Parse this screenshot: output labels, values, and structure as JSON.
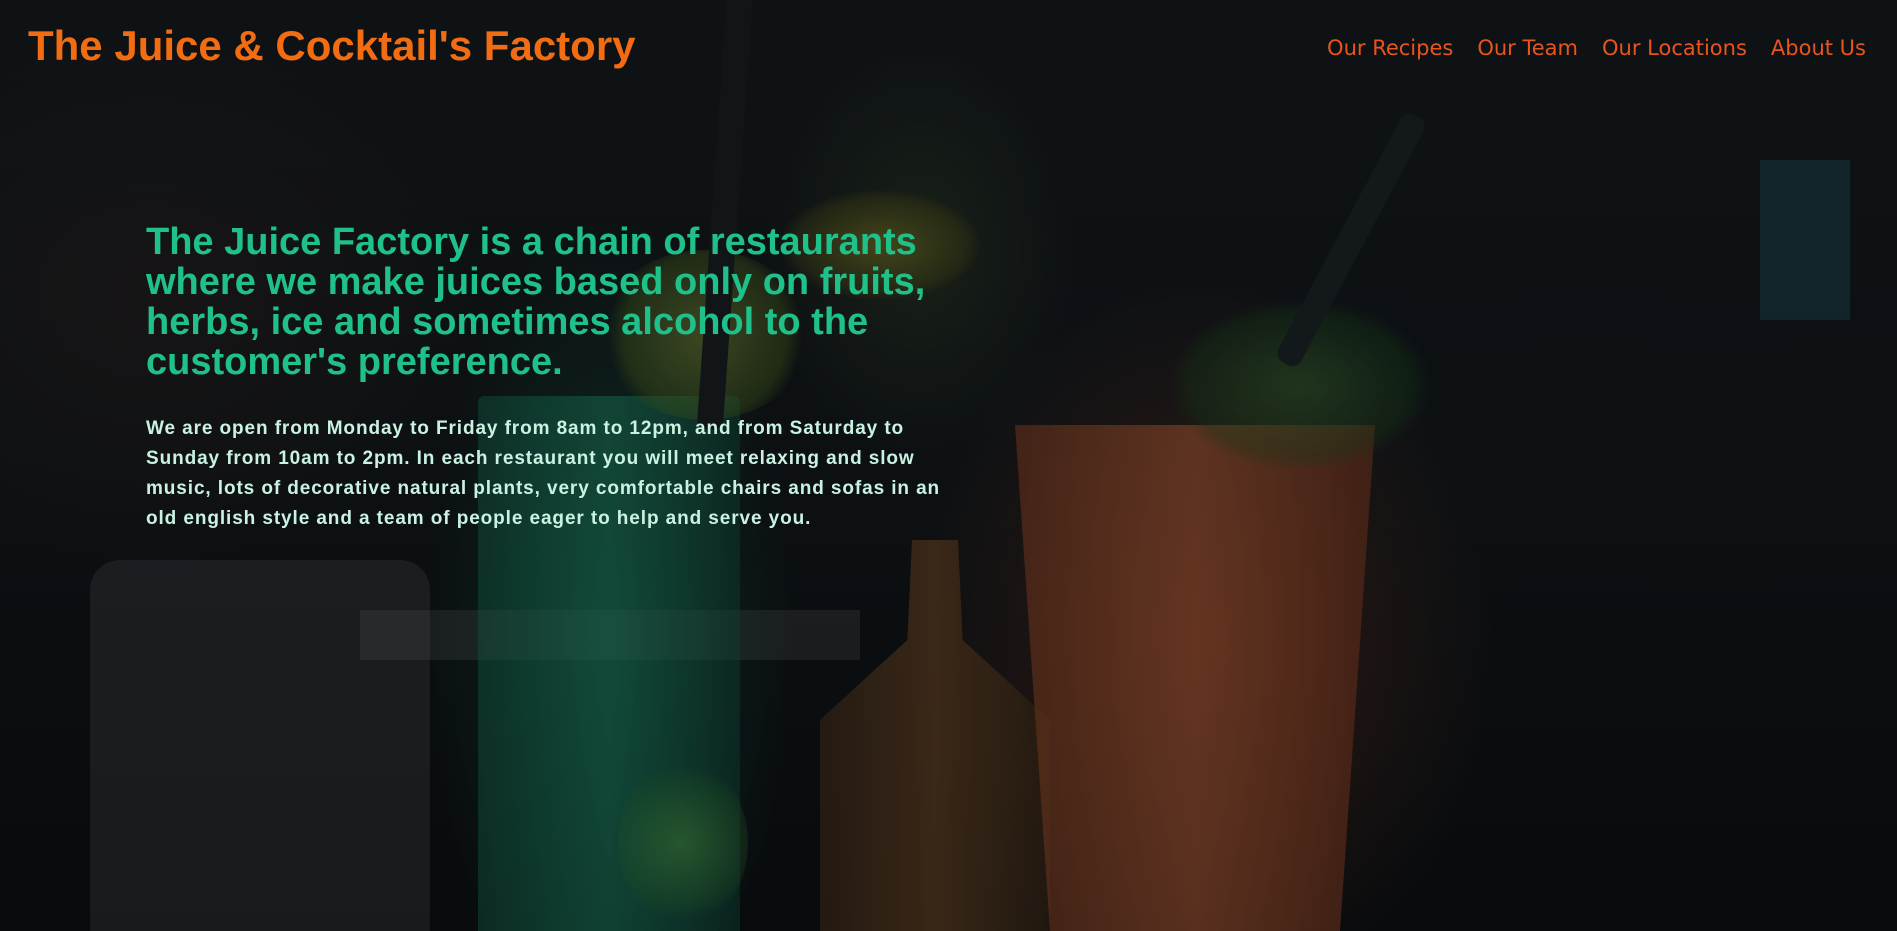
{
  "header": {
    "site_title": "The Juice & Cocktail's Factory"
  },
  "nav": {
    "items": [
      {
        "label": "Our Recipes"
      },
      {
        "label": "Our Team"
      },
      {
        "label": "Our Locations"
      },
      {
        "label": "About Us"
      }
    ]
  },
  "hero": {
    "heading": "The Juice Factory is a chain of restaurants where we make juices based only on fruits, herbs, ice and sometimes alcohol to the customer's preference.",
    "body": "We are open from Monday to Friday from 8am to 12pm, and from Saturday to Sunday from 10am to 2pm. In each restaurant you will meet relaxing and slow music, lots of decorative natural plants, very comfortable chairs and sofas in an old english style and a team of people eager to help and serve you."
  },
  "colors": {
    "title_orange": "#f26c12",
    "nav_orange": "#e8551c",
    "heading_green": "#1fc08a",
    "body_mint": "#c9f2e2"
  }
}
